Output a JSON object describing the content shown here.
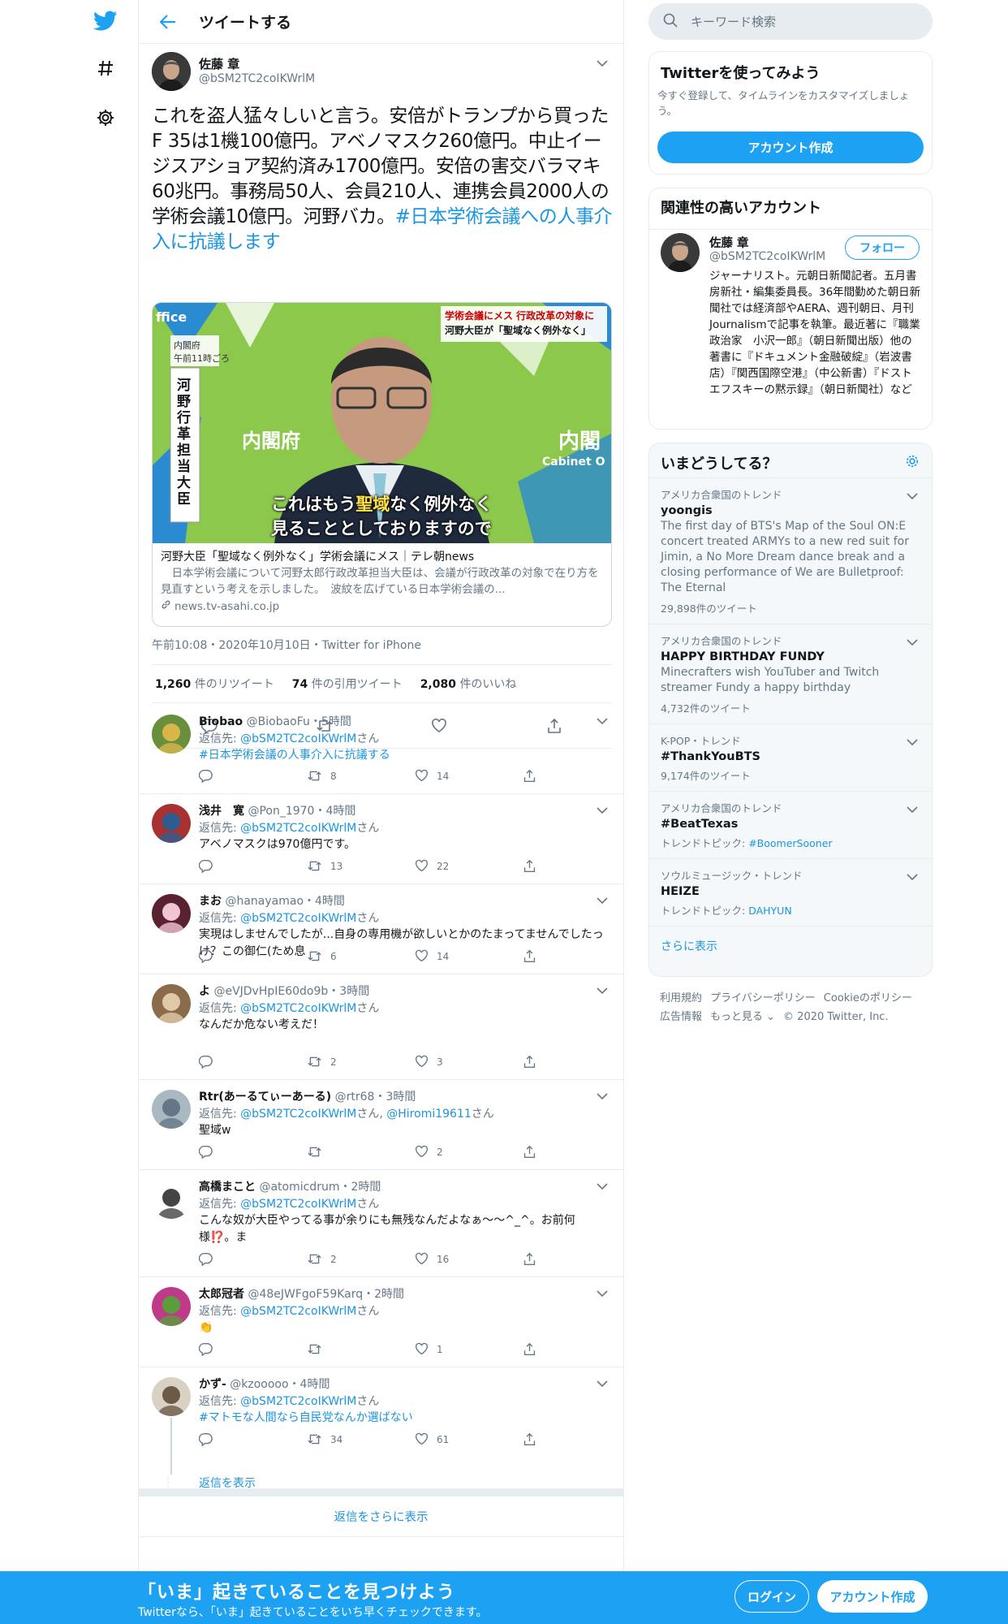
{
  "colors": {
    "accent": "#1da1f2",
    "link": "#1b95e0",
    "text": "#14171a",
    "secondary": "#657786",
    "border": "#e6ecf0"
  },
  "nav": {
    "icons": [
      "twitter-bird-icon",
      "hashtag-icon",
      "gear-icon"
    ]
  },
  "header": {
    "title": "ツイートする"
  },
  "tweet": {
    "name": "佐藤 章",
    "handle": "@bSM2TC2coIKWrlM",
    "text": "これを盗人猛々しいと言う。安倍がトランプから買ったF 35は1機100億円。アベノマスク260億円。中止イージスアショア契約済み1700億円。安倍の害交バラマキ60兆円。事務局50人、会員210人、連携会員2000人の学術会議10億円。河野バカ。",
    "hashtag": "#日本学術会議への人事介入に抗議します",
    "card": {
      "caption_top1": "学術会議にメス 行政改革の対象に",
      "caption_top2": "河野大臣が「聖域なく例外なく」",
      "label_place": "内閣府",
      "label_time": "午前11時ごろ",
      "label_vertical": "河野行革担当大臣",
      "logo_left": "ffice",
      "logo_right": "内閣",
      "logo_right_sub": "Cabinet O",
      "logo_center": "内閣府",
      "subtitle1_pre": "これはもう",
      "subtitle1_hl": "聖域",
      "subtitle1_post": "なく例外なく",
      "subtitle2": "見ることとしておりますので",
      "title": "河野大臣「聖域なく例外なく」学術会議にメス｜テレ朝news",
      "desc": "　日本学術会議について河野太郎行政改革担当大臣は、会議が行政改革の対象で在り方を見直すという考えを示しました。　波紋を広げている日本学術会議の...",
      "domain": "news.tv-asahi.co.jp"
    },
    "meta": "午前10:08・2020年10月10日・Twitter for iPhone",
    "retweets": "1,260",
    "retweets_label": "件のリツイート",
    "quotes": "74",
    "quotes_label": "件の引用ツイート",
    "likes": "2,080",
    "likes_label": "件のいいね"
  },
  "replies": [
    {
      "name": "Biobao",
      "handle": "@BiobaoFu",
      "time": "・5時間",
      "to_label": "返信先: ",
      "to": "@bSM2TC2coIKWrlM",
      "to_suffix": "さん",
      "to2": "",
      "to2_suffix": "",
      "text": "",
      "link_text": "#日本学術会議の人事介入に抗議する",
      "retweets": "8",
      "likes": "14"
    },
    {
      "name": "浅井　寛",
      "handle": "@Pon_1970",
      "time": "・4時間",
      "to_label": "返信先: ",
      "to": "@bSM2TC2coIKWrlM",
      "to_suffix": "さん",
      "to2": "",
      "to2_suffix": "",
      "text": "アベノマスクは970億円です。",
      "link_text": "",
      "retweets": "13",
      "likes": "22"
    },
    {
      "name": "まお",
      "handle": "@hanayamao",
      "time": "・4時間",
      "to_label": "返信先: ",
      "to": "@bSM2TC2coIKWrlM",
      "to_suffix": "さん",
      "to2": "",
      "to2_suffix": "",
      "text": "実現はしませんでしたが...自身の専用機が欲しいとかのたまってませんでしたっけ？この御仁(ため息",
      "link_text": "",
      "retweets": "6",
      "likes": "14"
    },
    {
      "name": "よ",
      "handle": "@eVJDvHpIE60do9b",
      "time": "・3時間",
      "to_label": "返信先: ",
      "to": "@bSM2TC2coIKWrlM",
      "to_suffix": "さん",
      "to2": "",
      "to2_suffix": "",
      "text": "なんだか危ない考えだ！",
      "link_text": "",
      "retweets": "2",
      "likes": "3"
    },
    {
      "name": "Rtr(あーるてぃーあーる)",
      "handle": "@rtr68",
      "time": "・3時間",
      "to_label": "返信先: ",
      "to": "@bSM2TC2coIKWrlM",
      "to_suffix": "さん, ",
      "to2": "@Hiromi19611",
      "to2_suffix": "さん",
      "text": "聖域w",
      "link_text": "",
      "retweets": "",
      "likes": "2"
    },
    {
      "name": "高橋まこと",
      "handle": "@atomicdrum",
      "time": "・2時間",
      "to_label": "返信先: ",
      "to": "@bSM2TC2coIKWrlM",
      "to_suffix": "さん",
      "to2": "",
      "to2_suffix": "",
      "text": "こんな奴が大臣やってる事が余りにも無残なんだよなぁ〜〜^_^。お前何様⁉️。ま",
      "link_text": "",
      "retweets": "2",
      "likes": "16"
    },
    {
      "name": "太郎冠者",
      "handle": "@48eJWFgoF59Karq",
      "time": "・2時間",
      "to_label": "返信先: ",
      "to": "@bSM2TC2coIKWrlM",
      "to_suffix": "さん",
      "to2": "",
      "to2_suffix": "",
      "text": "👏",
      "link_text": "",
      "retweets": "",
      "likes": "1"
    },
    {
      "name": "かず-",
      "handle": "@kzooooo",
      "time": "・4時間",
      "to_label": "返信先: ",
      "to": "@bSM2TC2coIKWrlM",
      "to_suffix": "さん",
      "to2": "",
      "to2_suffix": "",
      "text": "",
      "link_text": "#マトモな人間なら自民党なんか選ばない",
      "retweets": "34",
      "likes": "61"
    }
  ],
  "show_replies": "返信を表示",
  "more_replies": "返信をさらに表示",
  "search": {
    "placeholder": "キーワード検索"
  },
  "signup_box": {
    "title": "Twitterを使ってみよう",
    "text": "今すぐ登録して、タイムラインをカスタマイズしましょう。",
    "button": "アカウント作成"
  },
  "related": {
    "title": "関連性の高いアカウント",
    "name": "佐藤 章",
    "handle": "@bSM2TC2coIKWrlM",
    "follow": "フォロー",
    "bio": "ジャーナリスト。元朝日新聞記者。五月書房新社・編集委員長。36年間勤めた朝日新聞社では経済部やAERA、週刊朝日、月刊Journalismで記事を執筆。最近著に『職業政治家　小沢一郎』（朝日新聞出版）他の著書に『ドキュメント金融破綻』（岩波書店）『関西国際空港』（中公新書）『ドストエフスキーの黙示録』（朝日新聞社）など"
  },
  "trends": {
    "title": "いまどうしてる？",
    "items": [
      {
        "context": "アメリカ合衆国のトレンド",
        "name": "yoongis",
        "desc": "The first day of BTS's Map of the Soul ON:E concert treated ARMYs to a new red suit for Jimin, a No More Dream dance break and a closing performance of We are Bulletproof: The Eternal",
        "count": "29,898件のツイート",
        "topic_label": "",
        "topic": ""
      },
      {
        "context": "アメリカ合衆国のトレンド",
        "name": "HAPPY BIRTHDAY FUNDY",
        "desc": "Minecrafters wish YouTuber and Twitch streamer Fundy a happy birthday",
        "count": "4,732件のツイート",
        "topic_label": "",
        "topic": ""
      },
      {
        "context": "K-POP・トレンド",
        "name": "#ThankYouBTS",
        "desc": "",
        "count": "9,174件のツイート",
        "topic_label": "",
        "topic": ""
      },
      {
        "context": "アメリカ合衆国のトレンド",
        "name": "#BeatTexas",
        "desc": "",
        "count": "",
        "topic_label": "トレンドトピック: ",
        "topic": "#BoomerSooner"
      },
      {
        "context": "ソウルミュージック・トレンド",
        "name": "HEIZE",
        "desc": "",
        "count": "",
        "topic_label": "トレンドトピック: ",
        "topic": "DAHYUN"
      }
    ],
    "more": "さらに表示"
  },
  "footer": {
    "links": [
      "利用規約",
      "プライバシーポリシー",
      "Cookieのポリシー",
      "広告情報",
      "もっと見る ⌄",
      "© 2020 Twitter, Inc."
    ]
  },
  "bottombar": {
    "headline": "「いま」起きていることを見つけよう",
    "sub": "Twitterなら、「いま」起きていることをいち早くチェックできます。",
    "login": "ログイン",
    "signup": "アカウント作成"
  }
}
